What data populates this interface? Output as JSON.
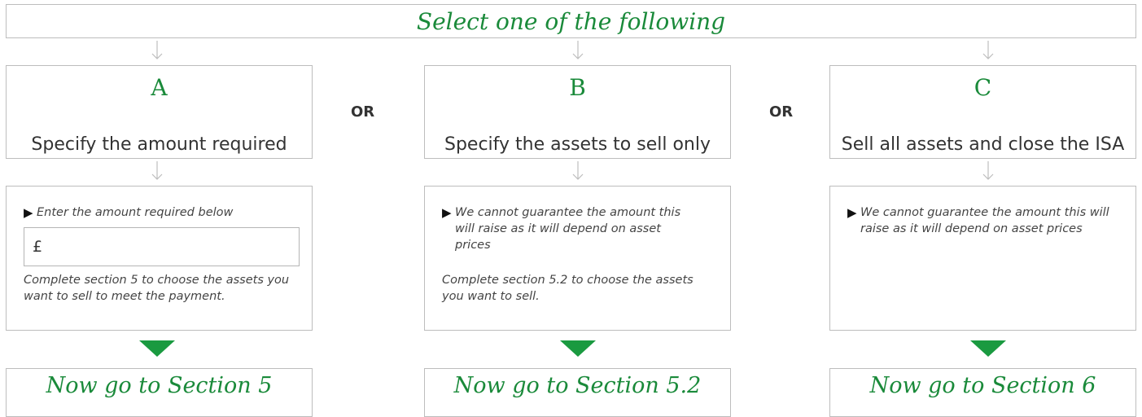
{
  "header": {
    "title": "Select one of the following"
  },
  "separator": "OR",
  "options": [
    {
      "letter": "A",
      "label": "Specify the amount required",
      "bullet": "Enter the amount required below",
      "amount_prefix": "£",
      "note": "Complete section 5 to choose the assets you want to sell to meet the payment.",
      "goto": "Now go to Section 5"
    },
    {
      "letter": "B",
      "label": "Specify the assets to sell only",
      "bullet": "We cannot guarantee the amount this will raise as it will depend on asset prices",
      "note": "Complete section 5.2 to choose the assets you want to sell.",
      "goto": "Now go to Section 5.2"
    },
    {
      "letter": "C",
      "label": "Sell all assets and close the ISA",
      "bullet": "We cannot guarantee the amount this will raise as it will depend on asset prices",
      "goto": "Now go to Section 6"
    }
  ],
  "colors": {
    "accent": "#1a8a3a",
    "triangle": "#1a9a40",
    "border": "#bdbdbd"
  }
}
